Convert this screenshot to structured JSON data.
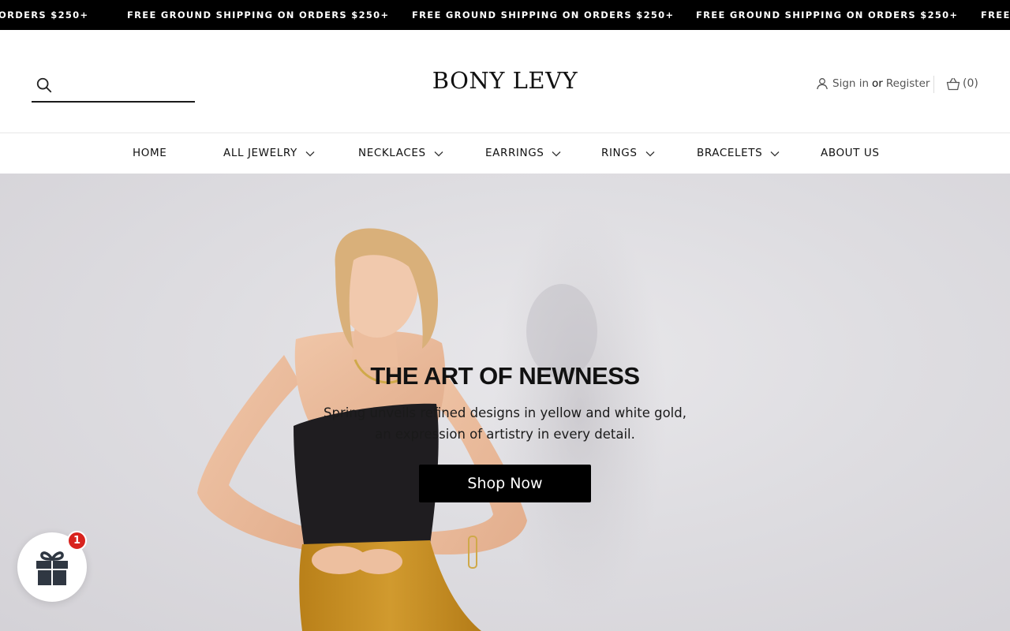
{
  "announcement": {
    "items": [
      "ORDERS $250+",
      "FREE GROUND SHIPPING ON ORDERS $250+",
      "FREE GROUND SHIPPING ON ORDERS $250+",
      "FREE GROUND SHIPPING ON ORDERS $250+",
      "FREE"
    ]
  },
  "header": {
    "logo": "BONY LEVY",
    "search_placeholder": "",
    "account": {
      "sign_in": "Sign in",
      "or": "or",
      "register": "Register"
    },
    "cart": {
      "label": "(0)"
    }
  },
  "nav": {
    "items": [
      {
        "label": "HOME"
      },
      {
        "label": "ALL JEWELRY"
      },
      {
        "label": "NECKLACES"
      },
      {
        "label": "EARRINGS"
      },
      {
        "label": "RINGS"
      },
      {
        "label": "BRACELETS"
      },
      {
        "label": "ABOUT US"
      }
    ]
  },
  "hero": {
    "title": "THE ART OF NEWNESS",
    "subtitle_line1": "Spring unveils refined designs in yellow and white gold,",
    "subtitle_line2": "an expression of artistry in every detail.",
    "button_label": "Shop Now"
  },
  "gift_widget": {
    "badge_count": "1"
  },
  "colors": {
    "announcement_bg": "#000000",
    "button_bg": "#000000",
    "badge": "#d8231e",
    "hero_bg": "#dedde1",
    "skirt": "#c78f26",
    "top": "#1e1c1e"
  }
}
